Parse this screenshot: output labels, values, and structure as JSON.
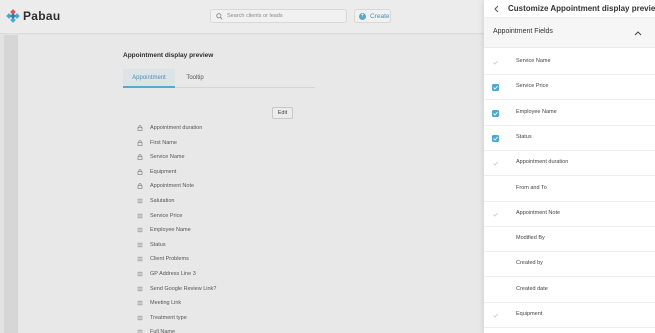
{
  "app": {
    "logo_text": "Pabau"
  },
  "topbar": {
    "search_placeholder": "Search clients or leads",
    "create_label": "Create"
  },
  "main": {
    "title": "Appointment display preview",
    "tabs": [
      {
        "label": "Appointment",
        "active": true
      },
      {
        "label": "Tooltip",
        "active": false
      }
    ],
    "edit_label": "Edit",
    "fields": [
      {
        "label": "Appointment duration",
        "icon": "lock-icon"
      },
      {
        "label": "First Name",
        "icon": "lock-icon"
      },
      {
        "label": "Service Name",
        "icon": "lock-icon"
      },
      {
        "label": "Equipment",
        "icon": "lock-icon"
      },
      {
        "label": "Appointment Note",
        "icon": "lock-icon"
      },
      {
        "label": "Salutation",
        "icon": "drag-handle-icon"
      },
      {
        "label": "Service Price",
        "icon": "drag-handle-icon"
      },
      {
        "label": "Employee Name",
        "icon": "drag-handle-icon"
      },
      {
        "label": "Status",
        "icon": "drag-handle-icon"
      },
      {
        "label": "Client Problems",
        "icon": "drag-handle-icon"
      },
      {
        "label": "GP Address Line 3",
        "icon": "drag-handle-icon"
      },
      {
        "label": "Send Google Review Link?",
        "icon": "drag-handle-icon"
      },
      {
        "label": "Meeting Link",
        "icon": "drag-handle-icon"
      },
      {
        "label": "Treatment type",
        "icon": "drag-handle-icon"
      },
      {
        "label": "Full Name",
        "icon": "drag-handle-icon"
      }
    ]
  },
  "panel": {
    "title": "Customize Appointment display preview",
    "section_title": "Appointment Fields",
    "items": [
      {
        "label": "Service Name",
        "state": "locked"
      },
      {
        "label": "Service Price",
        "state": "checked"
      },
      {
        "label": "Employee Name",
        "state": "checked"
      },
      {
        "label": "Status",
        "state": "checked"
      },
      {
        "label": "Appointment duration",
        "state": "locked"
      },
      {
        "label": "From and To",
        "state": "unchecked"
      },
      {
        "label": "Appointment Note",
        "state": "locked"
      },
      {
        "label": "Modified By",
        "state": "unchecked"
      },
      {
        "label": "Created by",
        "state": "unchecked"
      },
      {
        "label": "Created date",
        "state": "unchecked"
      },
      {
        "label": "Equipment",
        "state": "locked"
      }
    ]
  },
  "colors": {
    "accent": "#4aa9d2",
    "tab_active_text": "#4c8fb0",
    "logo_red": "#e0524f",
    "logo_blue": "#4aa9d2"
  }
}
